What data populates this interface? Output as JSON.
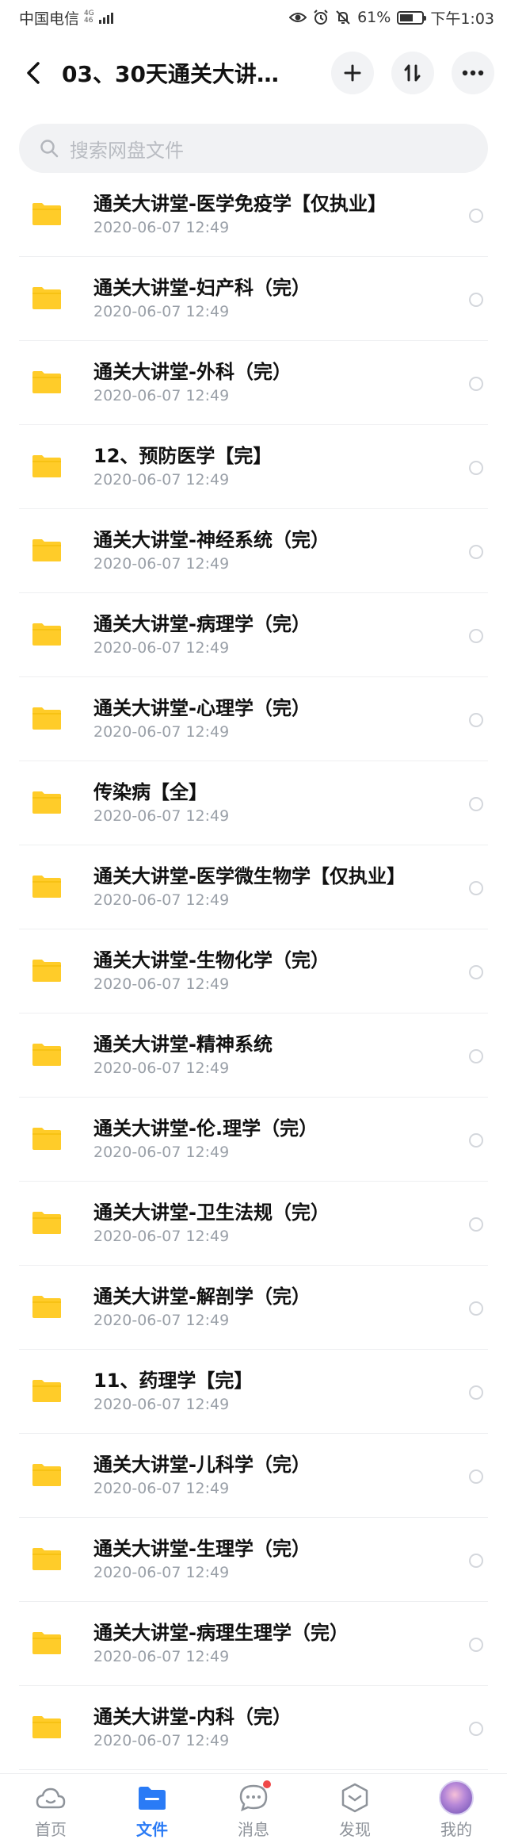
{
  "status_bar": {
    "carrier": "中国电信",
    "net_top": "4G",
    "net_bottom": "46",
    "battery_pct": "61%",
    "battery_level": 0.61,
    "time": "下午1:03"
  },
  "header": {
    "title": "03、30天通关大讲堂..."
  },
  "search": {
    "placeholder": "搜索网盘文件"
  },
  "files": [
    {
      "name": "通关大讲堂-医学免疫学【仅执业】",
      "date": "2020-06-07  12:49"
    },
    {
      "name": "通关大讲堂-妇产科（完）",
      "date": "2020-06-07  12:49"
    },
    {
      "name": "通关大讲堂-外科（完）",
      "date": "2020-06-07  12:49"
    },
    {
      "name": "12、预防医学【完】",
      "date": "2020-06-07  12:49"
    },
    {
      "name": "通关大讲堂-神经系统（完）",
      "date": "2020-06-07  12:49"
    },
    {
      "name": "通关大讲堂-病理学（完）",
      "date": "2020-06-07  12:49"
    },
    {
      "name": "通关大讲堂-心理学（完）",
      "date": "2020-06-07  12:49"
    },
    {
      "name": "传染病【全】",
      "date": "2020-06-07  12:49"
    },
    {
      "name": "通关大讲堂-医学微生物学【仅执业】",
      "date": "2020-06-07  12:49"
    },
    {
      "name": "通关大讲堂-生物化学（完）",
      "date": "2020-06-07  12:49"
    },
    {
      "name": "通关大讲堂-精神系统",
      "date": "2020-06-07  12:49"
    },
    {
      "name": "通关大讲堂-伦.理学（完）",
      "date": "2020-06-07  12:49"
    },
    {
      "name": "通关大讲堂-卫生法规（完）",
      "date": "2020-06-07  12:49"
    },
    {
      "name": "通关大讲堂-解剖学（完）",
      "date": "2020-06-07  12:49"
    },
    {
      "name": "11、药理学【完】",
      "date": "2020-06-07  12:49"
    },
    {
      "name": "通关大讲堂-儿科学（完）",
      "date": "2020-06-07  12:49"
    },
    {
      "name": "通关大讲堂-生理学（完）",
      "date": "2020-06-07  12:49"
    },
    {
      "name": "通关大讲堂-病理生理学（完）",
      "date": "2020-06-07  12:49"
    },
    {
      "name": "通关大讲堂-内科（完）",
      "date": "2020-06-07  12:49"
    }
  ],
  "tabs": [
    {
      "label": "首页",
      "icon": "cloud-icon"
    },
    {
      "label": "文件",
      "icon": "folder-icon"
    },
    {
      "label": "消息",
      "icon": "chat-icon"
    },
    {
      "label": "发现",
      "icon": "discover-icon"
    },
    {
      "label": "我的",
      "icon": "avatar"
    }
  ],
  "colors": {
    "accent": "#2a7bf6",
    "folder": "#ffcc29",
    "badge": "#f04848"
  }
}
